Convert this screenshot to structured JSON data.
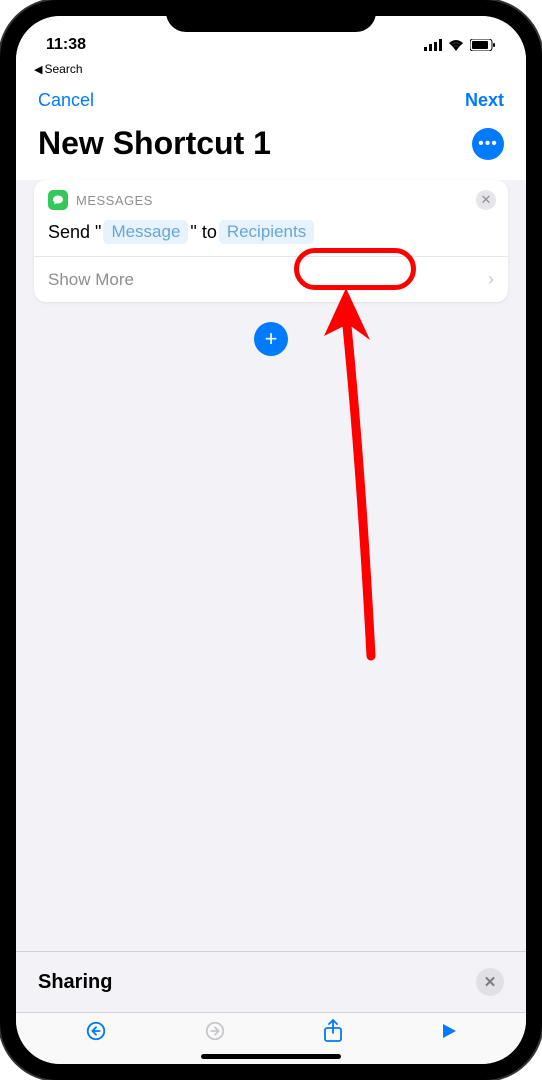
{
  "status": {
    "time": "11:38"
  },
  "back_nav": {
    "label": "Search"
  },
  "nav": {
    "cancel": "Cancel",
    "next": "Next"
  },
  "title": "New Shortcut 1",
  "action": {
    "app_name": "MESSAGES",
    "prefix": "Send \"",
    "message_token": "Message",
    "mid": "\" to",
    "recipients_token": "Recipients",
    "show_more": "Show More"
  },
  "sharing": {
    "title": "Sharing"
  }
}
